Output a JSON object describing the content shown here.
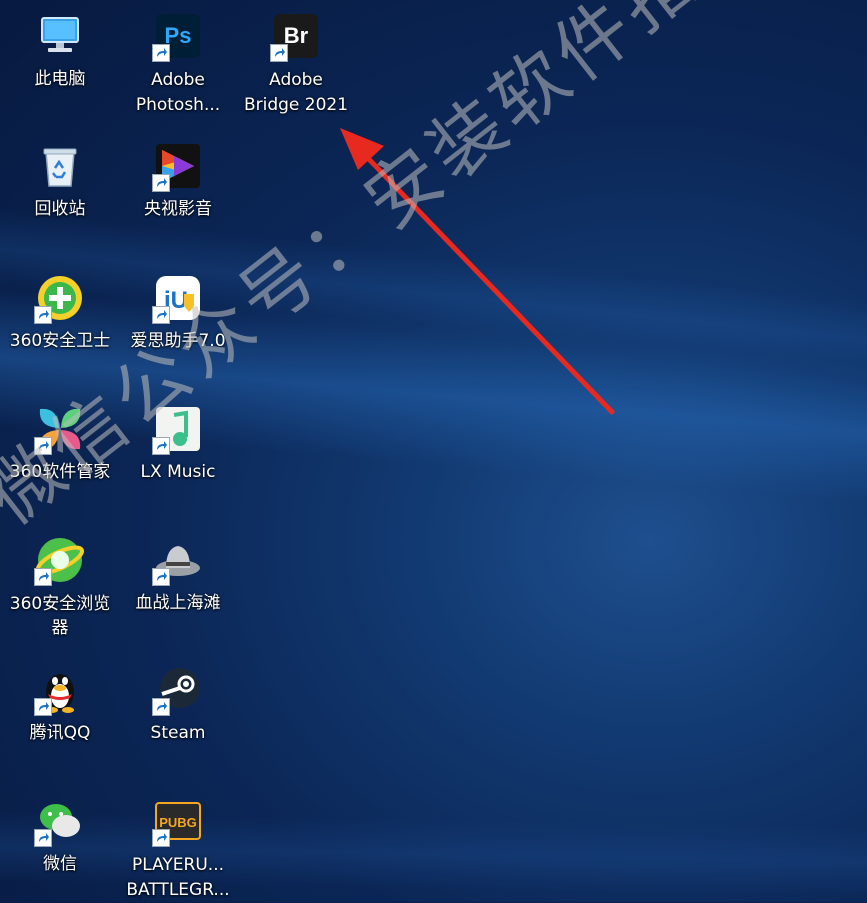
{
  "desktop": {
    "icons": [
      {
        "label": "此电脑",
        "icon": "this-pc-icon"
      },
      {
        "label": "Adobe\nPhotosh...",
        "icon": "photoshop-icon"
      },
      {
        "label": "Adobe\nBridge 2021",
        "icon": "bridge-icon"
      },
      {
        "label": "回收站",
        "icon": "recycle-bin-icon"
      },
      {
        "label": "央视影音",
        "icon": "cctv-video-icon"
      },
      {
        "label": "360安全卫士",
        "icon": "360-security-icon"
      },
      {
        "label": "爱思助手7.0",
        "icon": "i4-assistant-icon"
      },
      {
        "label": "360软件管家",
        "icon": "360-software-manager-icon"
      },
      {
        "label": "LX Music",
        "icon": "lx-music-icon"
      },
      {
        "label": "360安全浏览\n器",
        "icon": "360-browser-icon"
      },
      {
        "label": "血战上海滩",
        "icon": "game-hat-icon"
      },
      {
        "label": "腾讯QQ",
        "icon": "qq-penguin-icon"
      },
      {
        "label": "Steam",
        "icon": "steam-icon"
      },
      {
        "label": "微信",
        "icon": "wechat-icon"
      },
      {
        "label": "PLAYERU...\nBATTLEGR...",
        "icon": "pubg-icon"
      }
    ]
  },
  "overlay": {
    "watermark": "微信公众号：安装软件指南",
    "arrow_color": "#e8291f"
  },
  "colors": {
    "ps_bg": "#001e36",
    "ps_text": "#31a8ff",
    "br_bg": "#1a1a1a",
    "br_text": "#ffffff"
  }
}
